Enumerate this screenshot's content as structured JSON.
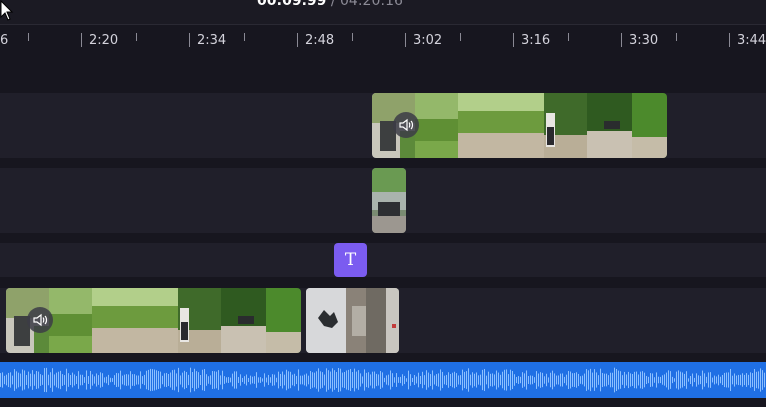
{
  "playback": {
    "current": "00:09.99",
    "separator": " / ",
    "total": "04:20:16"
  },
  "ruler": {
    "labels": [
      "6",
      "2:20",
      "2:34",
      "2:48",
      "3:02",
      "3:16",
      "3:30",
      "3:44"
    ]
  },
  "text_clip": {
    "label": "T"
  },
  "colors": {
    "background": "#17161f",
    "track": "#201f2a",
    "text_clip": "#7b5cf0",
    "audio": "#1f6fe4"
  }
}
